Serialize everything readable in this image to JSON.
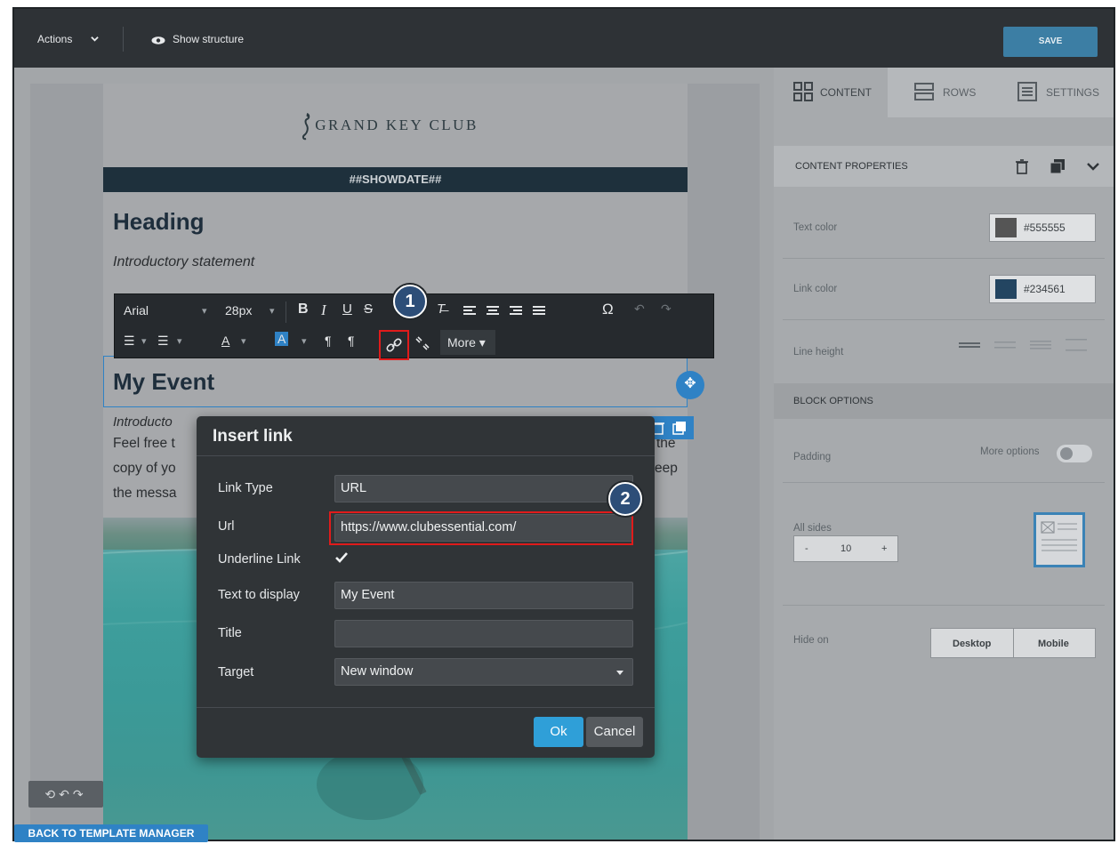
{
  "topbar": {
    "actions_label": "Actions",
    "show_structure_label": "Show structure",
    "save_label": "SAVE"
  },
  "email": {
    "logo_text": "GRAND KEY CLUB",
    "date_placeholder": "##SHOWDATE##",
    "heading": "Heading",
    "intro": "Introductory statement",
    "event_title": "My Event",
    "event_intro": "Introducto",
    "body_left_lines": [
      "Feel free t",
      "copy of yo",
      "the messa"
    ],
    "body_right_lines": [
      "the",
      "eep"
    ]
  },
  "toolbar": {
    "font": "Arial",
    "size": "28px",
    "more_label": "More"
  },
  "dialog": {
    "title": "Insert link",
    "fields": {
      "link_type_label": "Link Type",
      "link_type_value": "URL",
      "url_label": "Url",
      "url_value": "https://www.clubessential.com/",
      "underline_label": "Underline Link",
      "text_display_label": "Text to display",
      "text_display_value": "My Event",
      "title_label": "Title",
      "title_value": "",
      "target_label": "Target",
      "target_value": "New window"
    },
    "ok_label": "Ok",
    "cancel_label": "Cancel"
  },
  "callouts": {
    "one": "1",
    "two": "2"
  },
  "panel": {
    "tabs": {
      "content": "CONTENT",
      "rows": "ROWS",
      "settings": "SETTINGS"
    },
    "content_properties": "CONTENT PROPERTIES",
    "text_color_label": "Text color",
    "text_color_value": "#555555",
    "link_color_label": "Link color",
    "link_color_value": "#234561",
    "line_height_label": "Line height",
    "block_options": "BLOCK OPTIONS",
    "padding_label": "Padding",
    "more_options_label": "More options",
    "all_sides_label": "All sides",
    "padding_value": "10",
    "minus": "-",
    "plus": "+",
    "hide_on_label": "Hide on",
    "desktop_label": "Desktop",
    "mobile_label": "Mobile"
  },
  "footer": {
    "back_label": "BACK TO TEMPLATE MANAGER"
  },
  "colors": {
    "accent": "#2f82c5",
    "highlight": "#e01b1b",
    "text_swatch": "#555555",
    "link_swatch": "#234561"
  }
}
